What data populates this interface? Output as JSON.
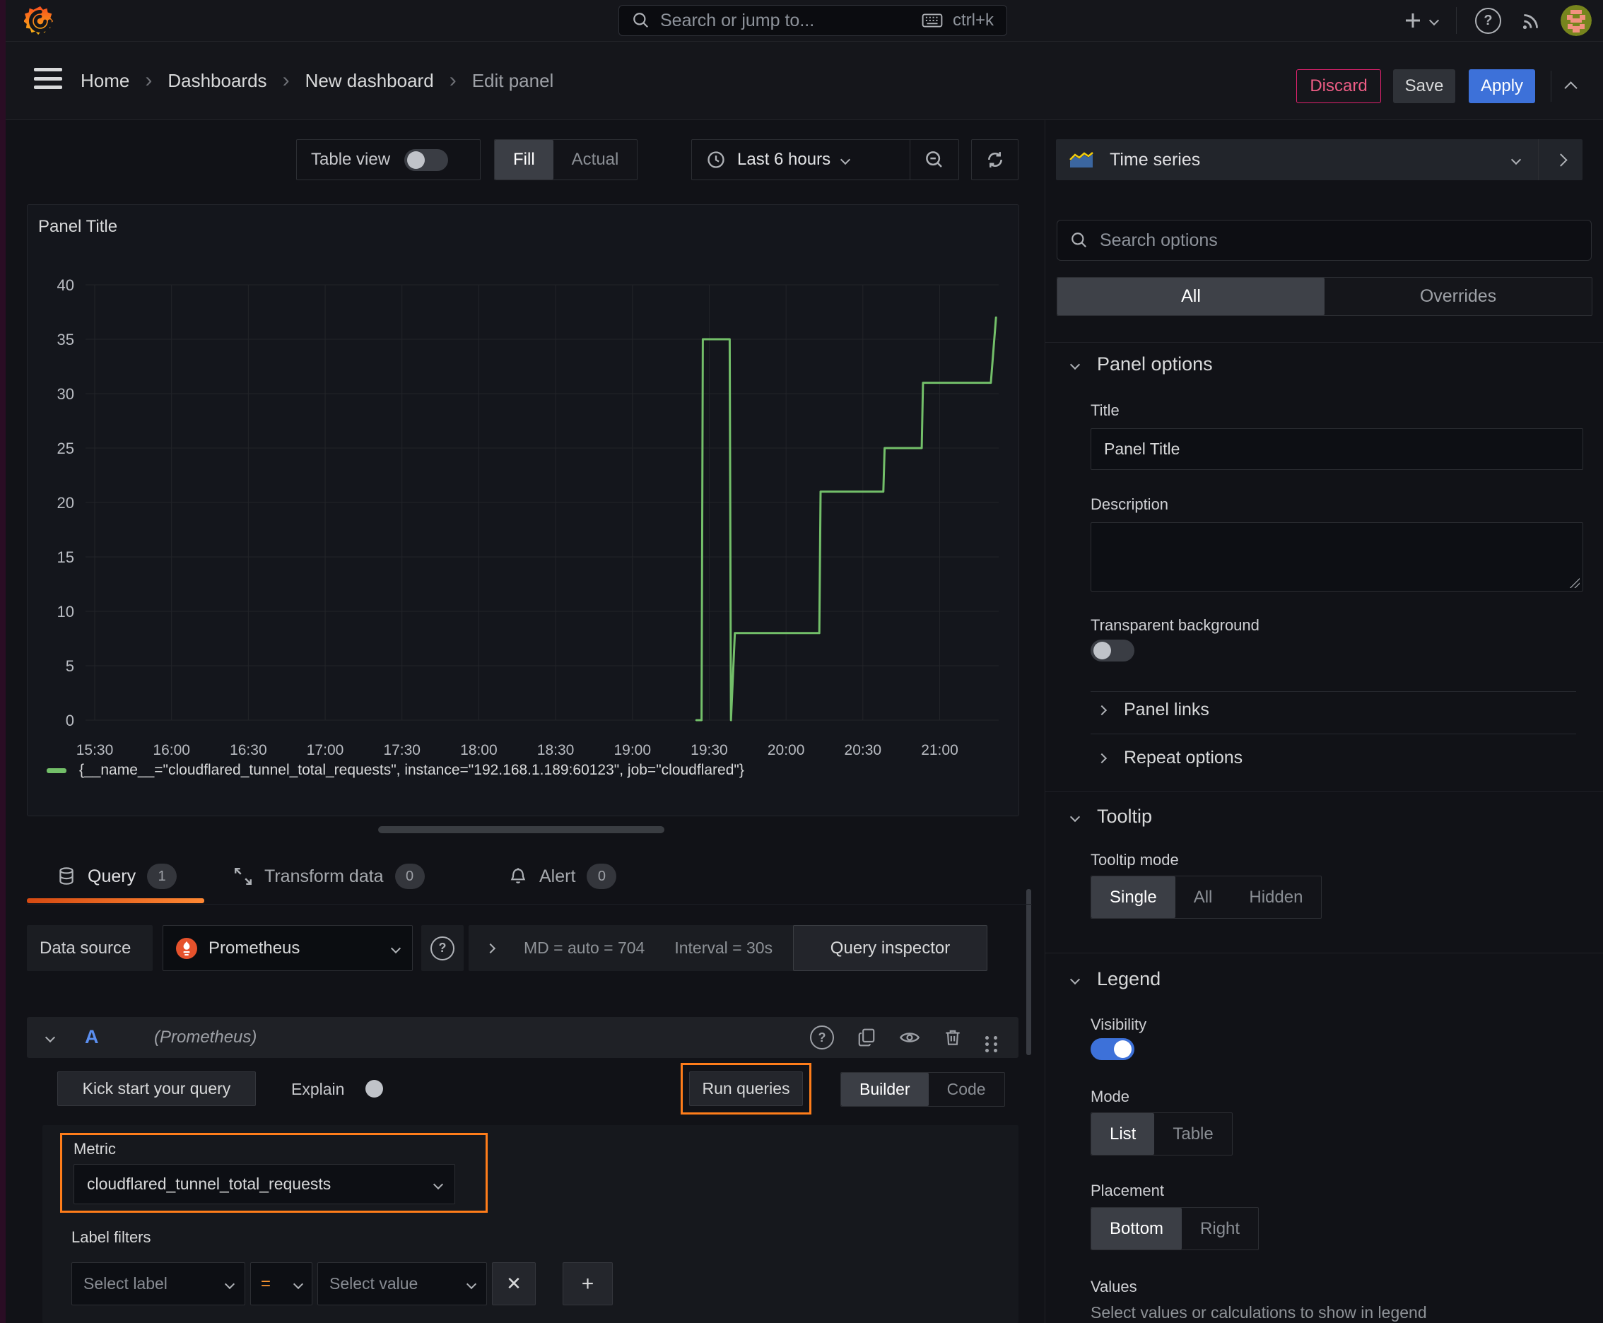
{
  "topbar": {
    "search_placeholder": "Search or jump to...",
    "shortcut": "ctrl+k"
  },
  "navbar": {
    "breadcrumbs": [
      "Home",
      "Dashboards",
      "New dashboard",
      "Edit panel"
    ],
    "discard_label": "Discard",
    "save_label": "Save",
    "apply_label": "Apply"
  },
  "panel_toolbar": {
    "table_view_label": "Table view",
    "fill_label": "Fill",
    "actual_label": "Actual",
    "time_range_label": "Last 6 hours"
  },
  "tabs": {
    "query_label": "Query",
    "query_count": "1",
    "transform_label": "Transform data",
    "transform_count": "0",
    "alert_label": "Alert",
    "alert_count": "0"
  },
  "query_toolbar": {
    "data_source_label": "Data source",
    "data_source_value": "Prometheus",
    "stats_md": "MD = auto = 704",
    "stats_interval": "Interval = 30s",
    "inspector_label": "Query inspector"
  },
  "query_editor": {
    "ref_id": "A",
    "datasource_hint": "(Prometheus)",
    "kick_start_label": "Kick start your query",
    "explain_label": "Explain",
    "run_queries_label": "Run queries",
    "builder_label": "Builder",
    "code_label": "Code",
    "metric_label": "Metric",
    "metric_value": "cloudflared_tunnel_total_requests",
    "label_filters_label": "Label filters",
    "select_label_placeholder": "Select label",
    "operator": "=",
    "select_value_placeholder": "Select value"
  },
  "options_pane": {
    "viz_type": "Time series",
    "search_placeholder": "Search options",
    "tab_all": "All",
    "tab_overrides": "Overrides",
    "panel_options_header": "Panel options",
    "title_label": "Title",
    "title_value": "Panel Title",
    "description_label": "Description",
    "transparent_label": "Transparent background",
    "panel_links_label": "Panel links",
    "repeat_options_label": "Repeat options",
    "tooltip_header": "Tooltip",
    "tooltip_mode_label": "Tooltip mode",
    "tooltip_modes": [
      "Single",
      "All",
      "Hidden"
    ],
    "legend_header": "Legend",
    "visibility_label": "Visibility",
    "mode_label": "Mode",
    "modes": [
      "List",
      "Table"
    ],
    "placement_label": "Placement",
    "placements": [
      "Bottom",
      "Right"
    ],
    "values_label": "Values",
    "values_hint": "Select values or calculations to show in legend"
  },
  "chart_data": {
    "type": "line",
    "title": "Panel Title",
    "ylim": [
      0,
      40
    ],
    "y_ticks": [
      0,
      5,
      10,
      15,
      20,
      25,
      30,
      35,
      40
    ],
    "x_unit": "minutes after 15:30",
    "x_ticks": [
      {
        "t": 0,
        "label": "15:30"
      },
      {
        "t": 30,
        "label": "16:00"
      },
      {
        "t": 60,
        "label": "16:30"
      },
      {
        "t": 90,
        "label": "17:00"
      },
      {
        "t": 120,
        "label": "17:30"
      },
      {
        "t": 150,
        "label": "18:00"
      },
      {
        "t": 180,
        "label": "18:30"
      },
      {
        "t": 210,
        "label": "19:00"
      },
      {
        "t": 240,
        "label": "19:30"
      },
      {
        "t": 270,
        "label": "20:00"
      },
      {
        "t": 300,
        "label": "20:30"
      },
      {
        "t": 330,
        "label": "21:00"
      }
    ],
    "grid": true,
    "legend_position": "bottom",
    "series": [
      {
        "name": "{__name__=\"cloudflared_tunnel_total_requests\", instance=\"192.168.1.189:60123\", job=\"cloudflared\"}",
        "color": "#73bf69",
        "points": [
          [
            235,
            0
          ],
          [
            237,
            0
          ],
          [
            237.5,
            35
          ],
          [
            248,
            35
          ],
          [
            248.5,
            0
          ],
          [
            250,
            8
          ],
          [
            283,
            8
          ],
          [
            283.5,
            21
          ],
          [
            308,
            21
          ],
          [
            308.5,
            25
          ],
          [
            323,
            25
          ],
          [
            323.5,
            31
          ],
          [
            350,
            31
          ],
          [
            352,
            37
          ]
        ]
      }
    ]
  },
  "colors": {
    "accent_orange": "#ff780a",
    "highlight_orange": "#ff7d1a",
    "primary_blue": "#3d71d9",
    "series_green": "#73bf69",
    "danger_pink": "#e0226e",
    "prometheus_orange": "#e6522c"
  }
}
